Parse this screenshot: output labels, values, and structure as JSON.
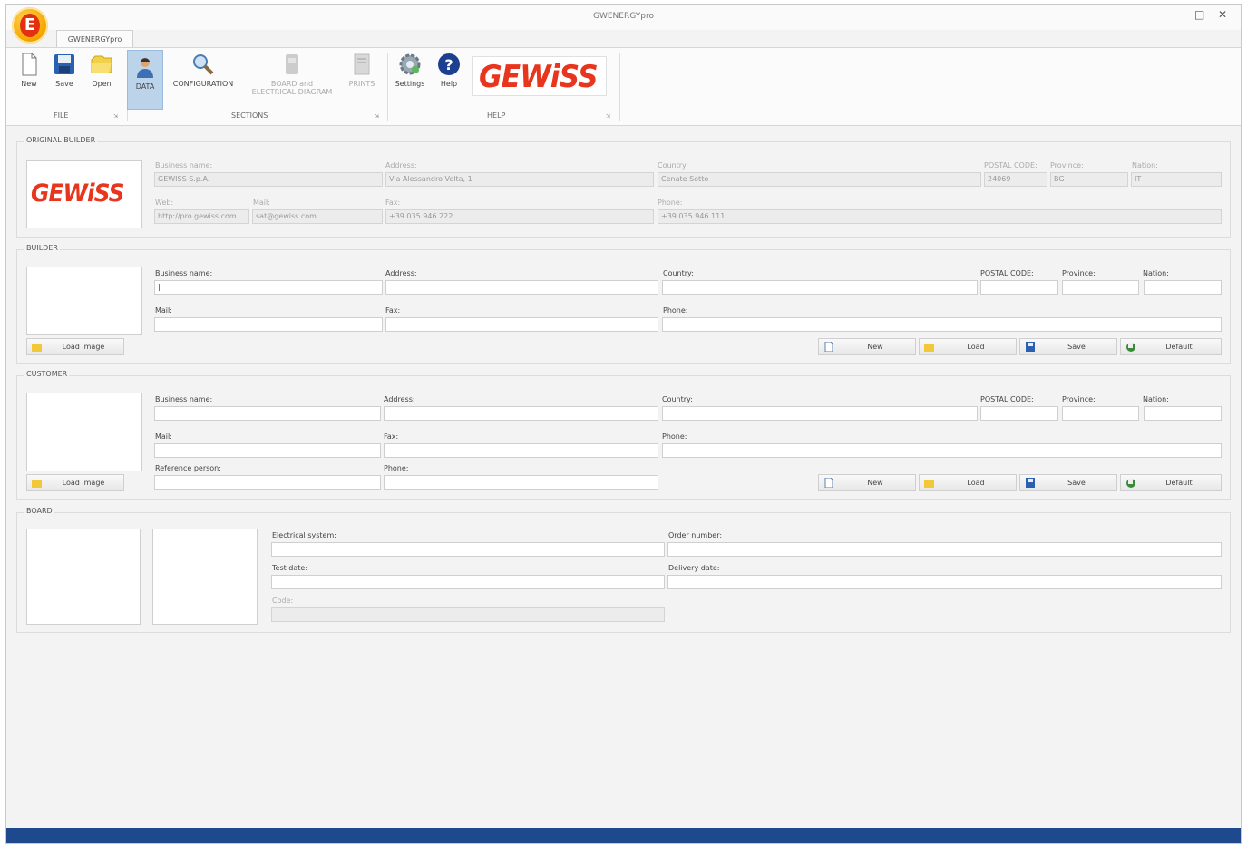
{
  "window": {
    "title": "GWENERGYpro",
    "tab_label": "GWENERGYpro"
  },
  "ribbon": {
    "file_group": "FILE",
    "sections_group": "SECTIONS",
    "help_group": "HELP",
    "new": "New",
    "save": "Save",
    "open": "Open",
    "data": "DATA",
    "configuration": "CONFIGURATION",
    "board_line1": "BOARD and",
    "board_line2": "ELECTRICAL DIAGRAM",
    "prints": "PRINTS",
    "settings": "Settings",
    "help": "Help",
    "brand": "GEWiSS"
  },
  "original_builder": {
    "legend": "ORIGINAL BUILDER",
    "logo": "GEWiSS",
    "labels": {
      "business_name": "Business name:",
      "address": "Address:",
      "country": "Country:",
      "postal_code": "POSTAL CODE:",
      "province": "Province:",
      "nation": "Nation:",
      "web": "Web:",
      "mail": "Mail:",
      "fax": "Fax:",
      "phone": "Phone:"
    },
    "values": {
      "business_name": "GEWISS S.p.A.",
      "address": "Via Alessandro Volta, 1",
      "country": "Cenate Sotto",
      "postal_code": "24069",
      "province": "BG",
      "nation": "IT",
      "web": "http://pro.gewiss.com",
      "mail": "sat@gewiss.com",
      "fax": "+39 035 946 222",
      "phone": "+39 035 946 111"
    }
  },
  "builder": {
    "legend": "BUILDER",
    "labels": {
      "business_name": "Business name:",
      "address": "Address:",
      "country": "Country:",
      "postal_code": "POSTAL CODE:",
      "province": "Province:",
      "nation": "Nation:",
      "mail": "Mail:",
      "fax": "Fax:",
      "phone": "Phone:"
    },
    "values": {
      "business_name": "|"
    },
    "load_image": "Load image",
    "buttons": {
      "new": "New",
      "load": "Load",
      "save": "Save",
      "default": "Default"
    }
  },
  "customer": {
    "legend": "CUSTOMER",
    "labels": {
      "business_name": "Business name:",
      "address": "Address:",
      "country": "Country:",
      "postal_code": "POSTAL CODE:",
      "province": "Province:",
      "nation": "Nation:",
      "mail": "Mail:",
      "fax": "Fax:",
      "phone": "Phone:",
      "reference_person": "Reference person:",
      "phone2": "Phone:"
    },
    "load_image": "Load image",
    "buttons": {
      "new": "New",
      "load": "Load",
      "save": "Save",
      "default": "Default"
    }
  },
  "board": {
    "legend": "BOARD",
    "labels": {
      "electrical_system": "Electrical system:",
      "order_number": "Order number:",
      "test_date": "Test date:",
      "delivery_date": "Delivery date:",
      "code": "Code:"
    }
  },
  "colors": {
    "brand_red": "#e8351d",
    "status_bar": "#1e4a8d",
    "active_tab": "#bcd4ea"
  }
}
